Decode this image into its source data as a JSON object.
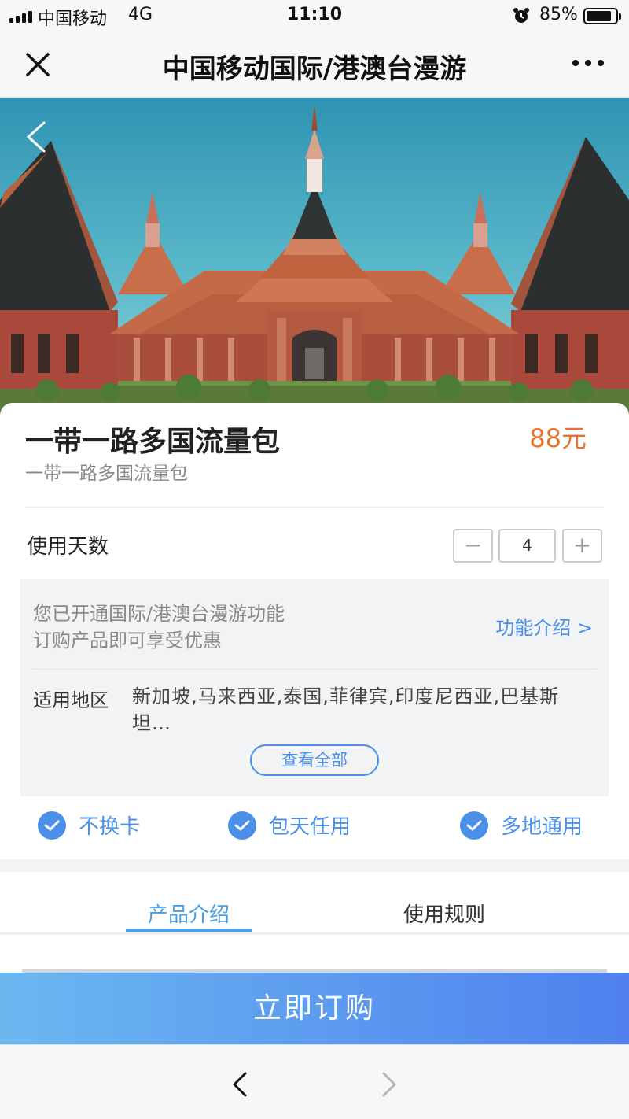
{
  "status_bar": {
    "carrier": "中国移动",
    "network": "4G",
    "time": "11:10",
    "battery_percent": "85%",
    "battery_level": 0.85,
    "icons": [
      "signal-icon",
      "alarm-icon",
      "battery-icon"
    ]
  },
  "nav": {
    "title": "中国移动国际/港澳台漫游",
    "close_icon": "close-icon",
    "more_icon": "more-icon"
  },
  "hero": {
    "back_icon": "chevron-left-icon"
  },
  "product": {
    "name": "一带一路多国流量包",
    "subtitle": "一带一路多国流量包",
    "price": "88元",
    "price_color": "#e8732f"
  },
  "usage_days": {
    "label": "使用天数",
    "minus": "−",
    "value": "4",
    "plus": "+"
  },
  "info": {
    "line1": "您已开通国际/港澳台漫游功能",
    "line2": "订购产品即可享受优惠",
    "feature_link": "功能介绍 >",
    "region_label": "适用地区",
    "region_value": "新加坡,马来西亚,泰国,菲律宾,印度尼西亚,巴基斯坦…",
    "view_all": "查看全部"
  },
  "features": [
    {
      "label": "不换卡",
      "icon": "check-icon"
    },
    {
      "label": "包天任用",
      "icon": "check-icon"
    },
    {
      "label": "多地通用",
      "icon": "check-icon"
    }
  ],
  "tabs": [
    {
      "label": "产品介绍",
      "active": true
    },
    {
      "label": "使用规则",
      "active": false
    }
  ],
  "buy_button": "立即订购",
  "bottom_bar": {
    "back_icon": "chevron-left-icon",
    "forward_icon": "chevron-right-icon"
  },
  "colors": {
    "accent": "#4a8fe8",
    "tab_active": "#4aa0e6",
    "buy_gradient_start": "#6ab8f0",
    "buy_gradient_end": "#4f80ee"
  }
}
